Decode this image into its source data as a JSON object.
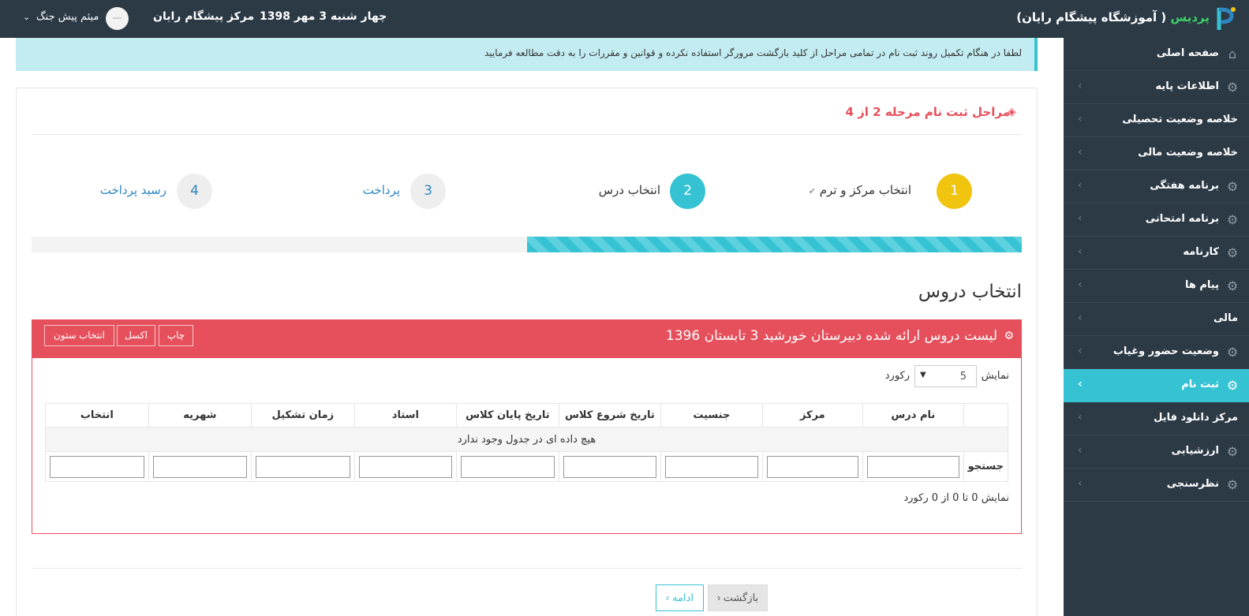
{
  "header": {
    "brand_name": "پردیس",
    "brand_org": "( آموزشگاه پیشگام رایان)",
    "date": "چهار شنبه 3 مهر 1398",
    "center": "مرکز پیشگام رایان",
    "user_name": "میثم پیش جنگ"
  },
  "sidebar": {
    "items": [
      {
        "label": "صفحه اصلی",
        "icon": "home-icon"
      },
      {
        "label": "اطلاعات پایه",
        "icon": "gear-icon"
      },
      {
        "label": "خلاصه وضعیت تحصیلی",
        "icon": ""
      },
      {
        "label": "خلاصه وضعیت مالی",
        "icon": ""
      },
      {
        "label": "برنامه هفتگی",
        "icon": "gear-icon"
      },
      {
        "label": "برنامه امتحانی",
        "icon": "gear-icon"
      },
      {
        "label": "کارنامه",
        "icon": "gear-icon"
      },
      {
        "label": "پیام ها",
        "icon": "gear-icon"
      },
      {
        "label": "مالی",
        "icon": ""
      },
      {
        "label": "وضعیت حضور وغیاب",
        "icon": "gear-icon"
      },
      {
        "label": "ثبت نام",
        "icon": "gear-icon",
        "active": true
      },
      {
        "label": "مرکز دانلود فایل",
        "icon": ""
      },
      {
        "label": "ارزشیابی",
        "icon": "gear-icon"
      },
      {
        "label": "نظرسنجی",
        "icon": "gear-icon"
      }
    ]
  },
  "alert": {
    "text": "لطفا در هنگام تکمیل روند ثبت نام در تمامی مراحل از کلید بازگشت مرورگر استفاده نکرده و قوانین و مقررات را به دقت مطالعه فرمایید"
  },
  "wizard": {
    "title": "مراحل ثبت نام مرحله 2 از 4",
    "steps": [
      {
        "number": "1",
        "label": "انتخاب مرکز و ترم",
        "state": "done"
      },
      {
        "number": "2",
        "label": "انتخاب درس",
        "state": "active"
      },
      {
        "number": "3",
        "label": "پرداخت",
        "state": "pending"
      },
      {
        "number": "4",
        "label": "رسید پرداخت",
        "state": "pending"
      }
    ],
    "progress_fraction": 0.5,
    "check_mark": "✔"
  },
  "courses": {
    "section_title": "انتخاب دروس",
    "card_title": "لیست دروس ارائه شده دبیرستان خورشید 3 تابستان 1396",
    "buttons": {
      "print": "چاپ",
      "excel": "اکسل",
      "columns": "انتخاب ستون"
    },
    "show_prefix": "نمایش",
    "show_suffix": "رکورد",
    "page_size": "5",
    "columns": [
      "",
      "نام درس",
      "مرکز",
      "جنسیت",
      "تاریخ شروع کلاس",
      "تاریخ پایان کلاس",
      "استاد",
      "زمان تشکیل",
      "شهریه",
      "انتخاب"
    ],
    "empty_message": "هیچ داده ای در جدول وجود ندارد",
    "search_label": "جستجو",
    "info": "نمایش 0 تا 0 از 0 رکورد"
  },
  "footer_buttons": {
    "back": "بازگشت ‹",
    "next": "ادامه ›"
  },
  "colors": {
    "topbar": "#2c3a46",
    "accent": "#35c3d4",
    "danger": "#e6505c",
    "step_done": "#f1c40f",
    "brand_green": "#3fcf6b"
  }
}
